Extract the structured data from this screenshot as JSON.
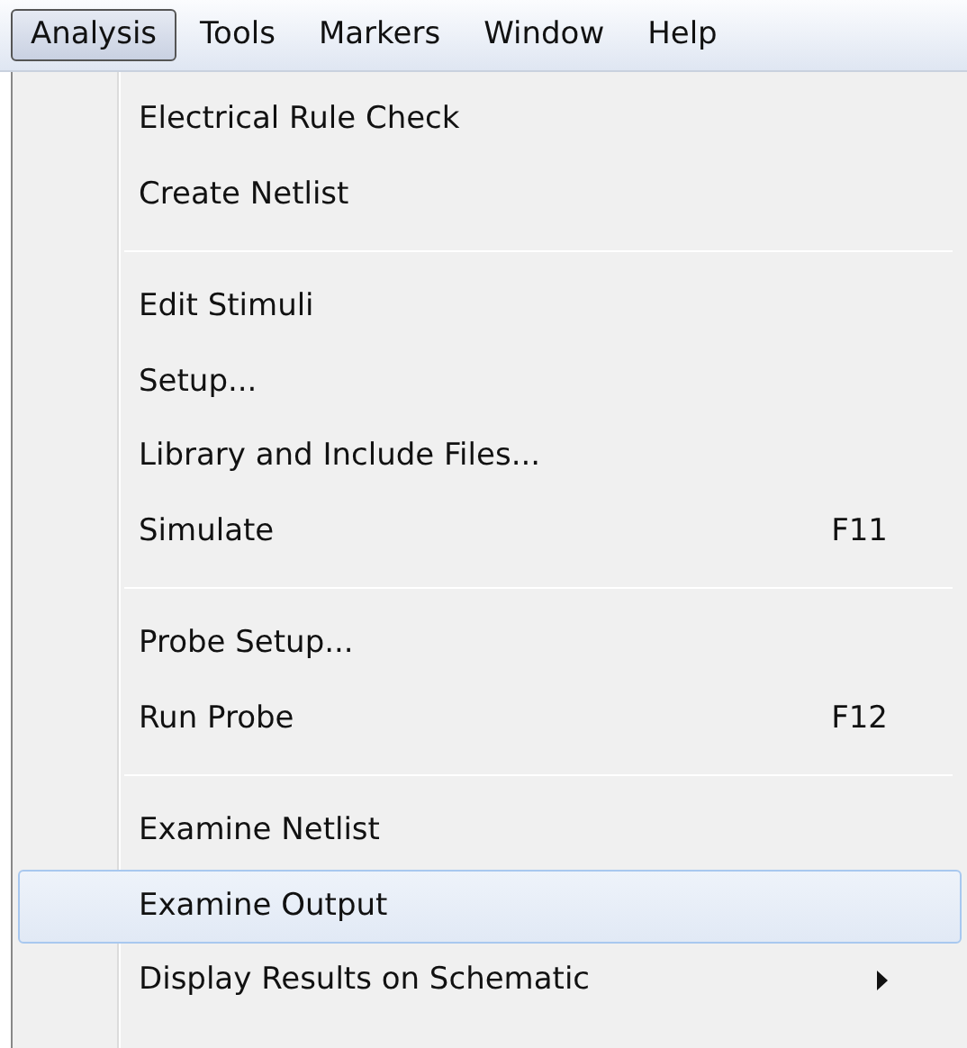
{
  "menubar": [
    {
      "label": "Analysis",
      "selected": true
    },
    {
      "label": "Tools",
      "selected": false
    },
    {
      "label": "Markers",
      "selected": false
    },
    {
      "label": "Window",
      "selected": false
    },
    {
      "label": "Help",
      "selected": false
    }
  ],
  "menu": [
    {
      "kind": "item",
      "label": "Electrical Rule Check",
      "selected": false
    },
    {
      "kind": "item",
      "label": "Create Netlist",
      "selected": false
    },
    {
      "kind": "separator"
    },
    {
      "kind": "item",
      "label": "Edit Stimuli",
      "selected": false
    },
    {
      "kind": "item",
      "label": "Setup...",
      "selected": false
    },
    {
      "kind": "item",
      "label": "Library and Include Files...",
      "selected": false
    },
    {
      "kind": "item",
      "label": "Simulate",
      "shortcut": "F11",
      "selected": false
    },
    {
      "kind": "separator"
    },
    {
      "kind": "item",
      "label": "Probe Setup...",
      "selected": false
    },
    {
      "kind": "item",
      "label": "Run Probe",
      "shortcut": "F12",
      "selected": false
    },
    {
      "kind": "separator"
    },
    {
      "kind": "item",
      "label": "Examine Netlist",
      "selected": false
    },
    {
      "kind": "item",
      "label": "Examine Output",
      "selected": true
    },
    {
      "kind": "item",
      "label": "Display Results on Schematic",
      "submenu": true,
      "selected": false
    }
  ]
}
